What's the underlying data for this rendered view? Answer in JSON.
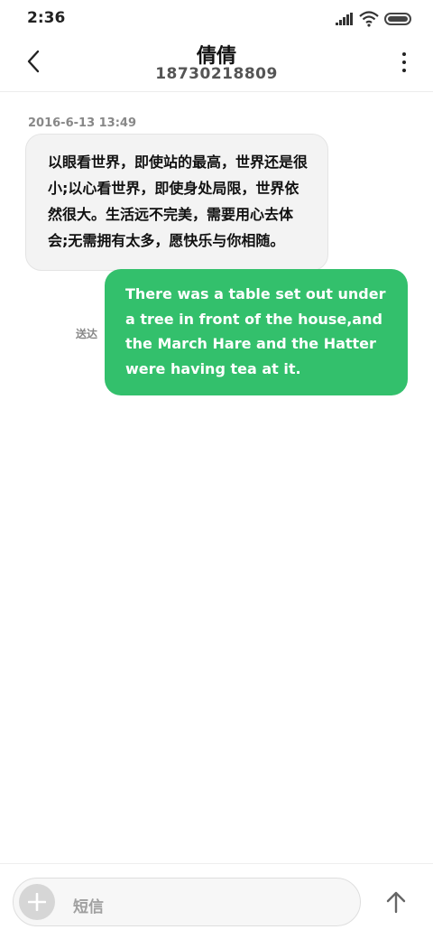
{
  "status_bar": {
    "time": "2:36",
    "icons": [
      "signal-icon",
      "wifi-icon",
      "battery-icon"
    ]
  },
  "header": {
    "contact_name": "倩倩",
    "phone_number": "18730218809",
    "icons": [
      "back-arrow-icon",
      "more-vertical-icon"
    ]
  },
  "conversation": {
    "timestamp": "2016-6-13 13:49",
    "incoming_message": "以眼看世界，即使站的最高，世界还是很小;以心看世界，即使身处局限，世界依然很大。生活远不完美，需要用心去体会;无需拥有太多，愿快乐与你相随。",
    "outgoing_message": "There was a table set out under a tree in front of the house,and the March Hare and the Hatter were having tea at it.",
    "delivery_status": "送达"
  },
  "composer": {
    "placeholder": "短信",
    "icons": [
      "plus-icon",
      "send-arrow-icon"
    ]
  },
  "colors": {
    "outgoing_bubble": "#33c06c",
    "incoming_bubble": "#f3f3f3"
  }
}
